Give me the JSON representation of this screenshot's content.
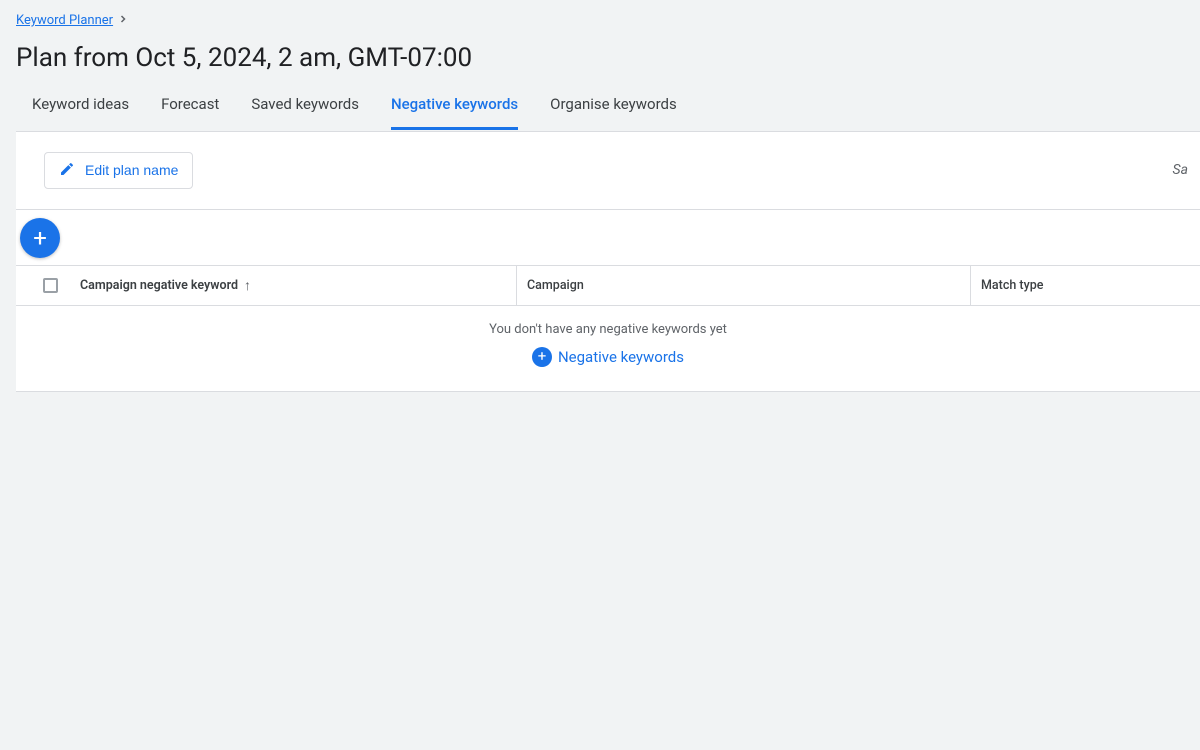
{
  "breadcrumb": {
    "label": "Keyword Planner"
  },
  "page_title": "Plan from Oct 5, 2024, 2 am, GMT-07:00",
  "tabs": {
    "keyword_ideas": "Keyword ideas",
    "forecast": "Forecast",
    "saved_keywords": "Saved keywords",
    "negative_keywords": "Negative keywords",
    "organise_keywords": "Organise keywords"
  },
  "toolbar": {
    "edit_label": "Edit plan name",
    "right_hint": "Sa"
  },
  "table": {
    "headers": {
      "campaign_negative_keyword": "Campaign negative keyword",
      "campaign": "Campaign",
      "match_type": "Match type"
    }
  },
  "empty_state": {
    "message": "You don't have any negative keywords yet",
    "cta_label": "Negative keywords"
  },
  "colors": {
    "accent": "#1a73e8",
    "body_bg": "#f1f3f4",
    "border": "#dadce0",
    "text": "#3c4043",
    "muted": "#5f6368"
  }
}
